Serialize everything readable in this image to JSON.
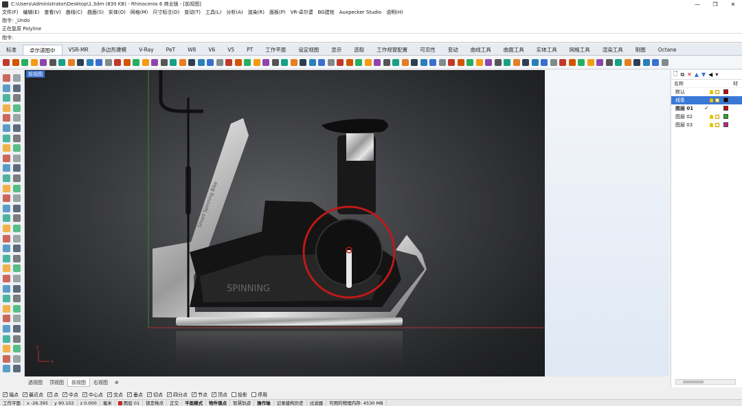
{
  "window": {
    "title": "C:\\Users\\Administrator\\Desktop\\1.3dm (830 KB) - Rhinoceros 6 商业版 - [前视图]",
    "controls": [
      "—",
      "❐",
      "✕"
    ]
  },
  "menu": [
    "文件(F)",
    "编辑(E)",
    "查看(V)",
    "曲线(C)",
    "曲面(S)",
    "实体(O)",
    "网格(M)",
    "尺寸标注(D)",
    "变动(T)",
    "工具(L)",
    "分析(A)",
    "渲染(R)",
    "面板(P)",
    "VR-卓尔谟",
    "BG建栓",
    "Auxpecker Studio",
    "说明(H)"
  ],
  "command": {
    "history1": "指令: _Undo",
    "history2": "正在复原 Polyline",
    "prompt": "指令:"
  },
  "tabs": [
    "标准",
    "卓尔谟图中",
    "VSR-MR",
    "多边形建模",
    "V-Ray",
    "PeT",
    "W8",
    "V6",
    "V5",
    "PT",
    "工作平面",
    "设定视图",
    "显示",
    "选取",
    "工作视窗配置",
    "可见性",
    "变动",
    "曲线工具",
    "曲面工具",
    "实体工具",
    "网格工具",
    "渲染工具",
    "制图",
    "Octane"
  ],
  "active_tab": "卓尔谟图中",
  "viewport": {
    "label": "前视图",
    "tabs": [
      "透视图",
      "顶视图",
      "前视图",
      "右视图"
    ],
    "active_tab": "前视图",
    "add_tab": "⊕",
    "bike_brand": "SPINNING",
    "bike_frame_text": "Smart Spinning Bike",
    "axis_x": "x",
    "axis_y": "y"
  },
  "layers": {
    "toolbar_icons": [
      "new-layer-icon",
      "new-sublayer-icon",
      "delete-icon",
      "up-icon",
      "down-icon",
      "filter-icon",
      "menu-icon"
    ],
    "header_name": "名称",
    "header_material": "材",
    "rows": [
      {
        "name": "默认",
        "color": "#cc0000",
        "selected": false,
        "current": false
      },
      {
        "name": "线条",
        "color": "#000000",
        "selected": true,
        "current": false
      },
      {
        "name": "图层 01",
        "color": "#cc0000",
        "selected": false,
        "current": true
      },
      {
        "name": "图层 02",
        "color": "#22aa22",
        "selected": false,
        "current": false
      },
      {
        "name": "图层 03",
        "color": "#cc2288",
        "selected": false,
        "current": false
      }
    ]
  },
  "osnap": [
    {
      "label": "端点",
      "on": true
    },
    {
      "label": "最近点",
      "on": true
    },
    {
      "label": "点",
      "on": true
    },
    {
      "label": "中点",
      "on": true
    },
    {
      "label": "中心点",
      "on": true
    },
    {
      "label": "交点",
      "on": true
    },
    {
      "label": "垂点",
      "on": true
    },
    {
      "label": "切点",
      "on": true
    },
    {
      "label": "四分点",
      "on": true
    },
    {
      "label": "节点",
      "on": true
    },
    {
      "label": "顶点",
      "on": true
    },
    {
      "label": "投影",
      "on": false
    },
    {
      "label": "停用",
      "on": false
    }
  ],
  "status": {
    "plane": "工作平面",
    "x": "x -26.395",
    "y": "y 90.102",
    "z": "z 0.000",
    "unit": "毫米",
    "layer": "图层 01",
    "items": [
      "锁定格点",
      "正交",
      "平面模式",
      "物件锁点",
      "智慧轨迹",
      "操作轴",
      "记录建构历史",
      "过滤器",
      "可用的物理内存: 4530 MB"
    ],
    "bold_items": [
      "平面模式",
      "物件锁点",
      "操作轴"
    ]
  },
  "colors": {
    "highlight_circle": "#c01818",
    "layer_selected": "#3a78d8",
    "construction_red": "#b03030",
    "construction_green": "#2e8b2e"
  }
}
